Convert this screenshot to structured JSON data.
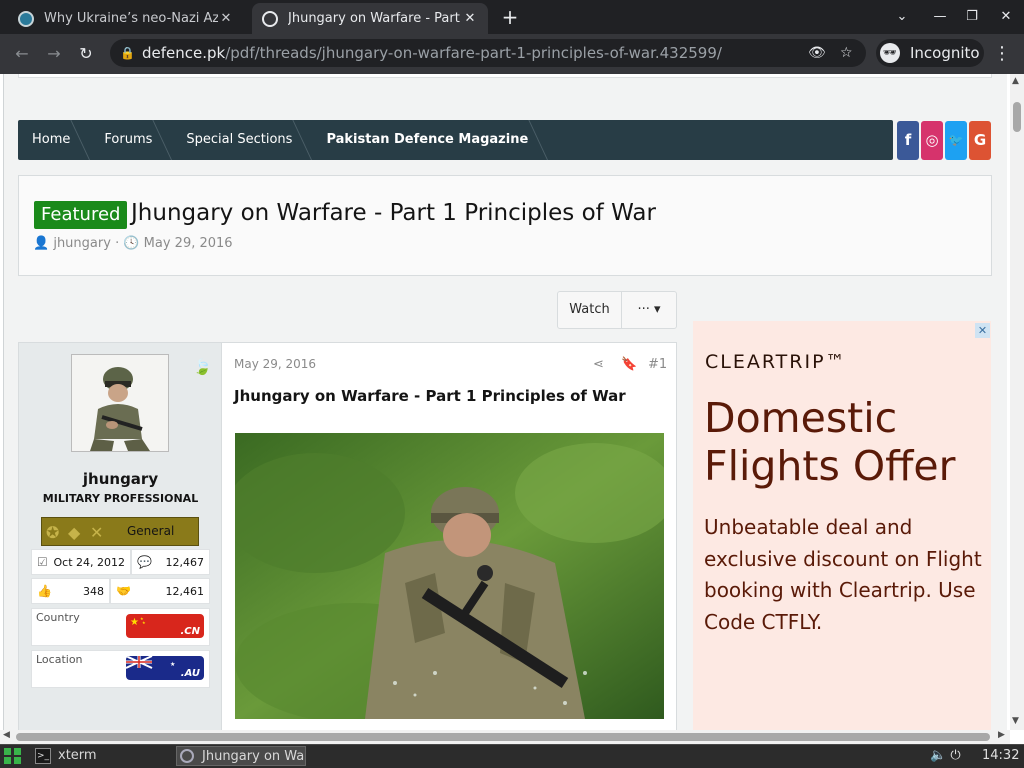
{
  "browser": {
    "tabs": [
      {
        "title": "Why Ukraine’s neo-Nazi Az",
        "active": false
      },
      {
        "title": "Jhungary on Warfare - Part",
        "active": true
      }
    ],
    "url_host": "defence.pk",
    "url_path": "/pdf/threads/jhungary-on-warfare-part-1-principles-of-war.432599/",
    "profile_label": "Incognito"
  },
  "breadcrumb": [
    "Home",
    "Forums",
    "Special Sections",
    "Pakistan Defence Magazine"
  ],
  "social": [
    {
      "icon": "facebook-icon",
      "glyph": "f",
      "color": "#3b5998"
    },
    {
      "icon": "instagram-icon",
      "glyph": "◎",
      "color": "#d6336c"
    },
    {
      "icon": "twitter-icon",
      "glyph": "🐦",
      "color": "#1da1f2"
    },
    {
      "icon": "google-icon",
      "glyph": "G",
      "color": "#dd5333"
    }
  ],
  "thread": {
    "badge": "Featured",
    "title": "Jhungary on Warfare - Part 1 Principles of War",
    "author": "jhungary",
    "date": "May 29, 2016"
  },
  "actions": {
    "watch": "Watch",
    "more": "···"
  },
  "post": {
    "date": "May 29, 2016",
    "number": "#1",
    "title": "Jhungary on Warfare - Part 1 Principles of War"
  },
  "user": {
    "name": "jhungary",
    "title": "MILITARY PROFESSIONAL",
    "rank": "General",
    "joined": "Oct 24, 2012",
    "messages": "12,467",
    "reactions": "348",
    "points": "12,461",
    "country_label": "Country",
    "country_code": ".CN",
    "location_label": "Location",
    "location_code": ".AU"
  },
  "ad": {
    "brand": "CLEARTRIP™",
    "headline": "Domestic Flights Offer",
    "body": "Unbeatable deal and exclusive discount on Flight booking with Cleartrip. Use Code CTFLY."
  },
  "taskbar": {
    "tasks": [
      "xterm",
      "Jhungary on Wa"
    ],
    "clock": "14:32"
  }
}
